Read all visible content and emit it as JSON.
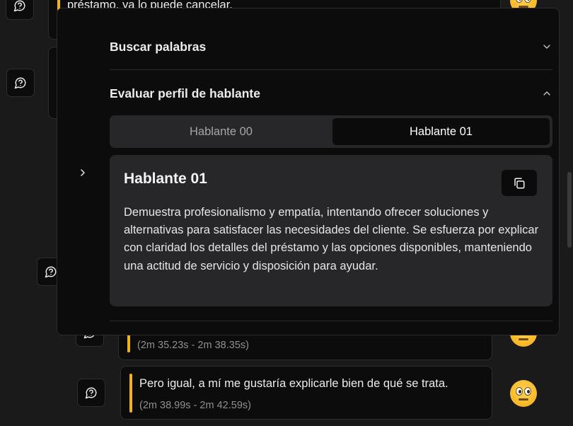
{
  "transcript": {
    "top_message_text": "préstamo, ya lo puede cancelar.",
    "message_1_time": "(2m 35.23s - 2m 38.35s)",
    "message_2_text": "Pero igual, a mí me gustaría explicarle bien de qué se trata.",
    "message_2_time": "(2m 38.99s - 2m 42.59s)"
  },
  "panel": {
    "section_search_label": "Buscar palabras",
    "section_profile_label": "Evaluar perfil de hablante",
    "tabs": [
      {
        "label": "Hablante 00",
        "active": false
      },
      {
        "label": "Hablante 01",
        "active": true
      }
    ],
    "profile": {
      "title": "Hablante 01",
      "description": "Demuestra profesionalismo y empatía, intentando ofrecer soluciones y alternativas para satisfacer las necesidades del cliente. Se esfuerza por explicar con claridad los detalles del préstamo y las opciones disponibles, manteniendo una actitud de servicio y disposición para ayudar."
    }
  },
  "icons": {
    "message_action": "message-circle-question-icon",
    "emoji": "flushed-face-icon",
    "collapse": "chevron-right-icon",
    "accordion_closed": "chevron-down-icon",
    "accordion_open": "chevron-up-icon",
    "copy": "copy-icon"
  },
  "colors": {
    "accent_bar": "#f0b416",
    "background": "#1a1a1b",
    "panel": "#0c0c0d",
    "card": "#27272a"
  }
}
